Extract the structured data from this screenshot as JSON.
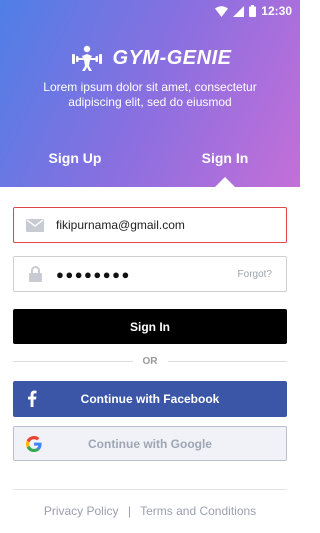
{
  "status_bar": {
    "time": "12:30"
  },
  "brand": {
    "name": "GYM-GENIE",
    "logo_icon": "dumbbell-person-icon"
  },
  "header": {
    "tagline": "Lorem ipsum dolor sit amet, consectetur adipiscing elit, sed do eiusmod",
    "tabs": [
      {
        "label": "Sign Up",
        "active": false
      },
      {
        "label": "Sign In",
        "active": true
      }
    ]
  },
  "form": {
    "email": {
      "value": "fikipurnama@gmail.com",
      "icon": "mail-icon"
    },
    "password": {
      "value": "●●●●●●●●",
      "icon": "lock-icon",
      "forgot_label": "Forgot?"
    },
    "signin_label": "Sign In",
    "or_label": "OR"
  },
  "social": {
    "facebook_label": "Continue with Facebook",
    "google_label": "Continue with Google"
  },
  "footer": {
    "privacy": "Privacy Policy",
    "separator": "|",
    "terms": "Terms and Conditions"
  },
  "colors": {
    "gradient_start": "#4f7fe6",
    "gradient_end": "#c46fd8",
    "error_border": "#e0454b",
    "facebook_blue": "#3b56a7",
    "button_black": "#000000"
  }
}
